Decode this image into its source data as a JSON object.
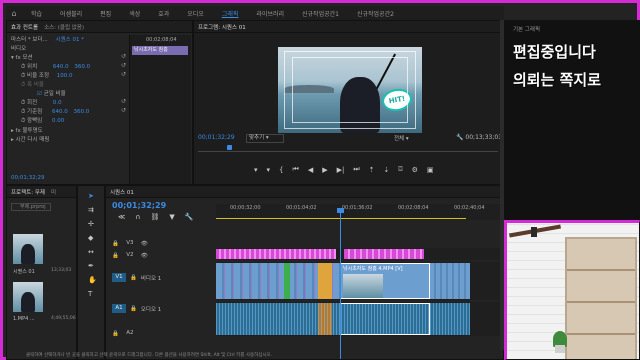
{
  "menu": {
    "items": [
      "학습",
      "어셈블리",
      "편집",
      "색상",
      "효과",
      "오디오",
      "그래픽",
      "라이브러리",
      "신규작업공간1",
      "신규작업공간2"
    ],
    "active_index": 6
  },
  "effect_controls": {
    "tabs": [
      "효과 컨트롤",
      "소스: (클립 없음)"
    ],
    "source": "마스터 * 보더...",
    "sequence": "시퀀스 01 *",
    "timecode": "00;02;08;04",
    "clip_label": "낚시초자도 참홈",
    "section_video": "비디오",
    "motion": "모션",
    "position_label": "위치",
    "position_x": "640.0",
    "position_y": "360.0",
    "scale_label": "비율 조정",
    "scale_value": "100.0",
    "scale_width_label": "폭 비율",
    "uniform_label": "균일 비율",
    "rotation_label": "회전",
    "rotation_value": "0.0",
    "anchor_label": "기준점",
    "anchor_x": "640.0",
    "anchor_y": "360.0",
    "antiflicker_label": "깜빡임",
    "antiflicker_value": "0.00",
    "opacity_label": "불투명도",
    "time_remap_label": "시간 다시 매핑",
    "footer_timecode": "00;01;32;29"
  },
  "program": {
    "tab": "프로그램: 시퀀스 01",
    "timecode": "00;01;32;29",
    "fit": "맞추기",
    "quality": "전체",
    "duration": "00;13;33;03",
    "overlay_badge": "HIT!"
  },
  "essential_graphics": {
    "tab": "기본 그래픽",
    "line1": "편집중입니다",
    "line2": "의뢰는 쪽지로"
  },
  "project": {
    "tabs": [
      "프로젝트: 무제",
      "미"
    ],
    "search_placeholder": "무제.prproj",
    "items": [
      {
        "name": "시퀀스 01",
        "duration": "13;33;03"
      },
      {
        "name": "1.MP4 ...",
        "duration": "4;49;55;06"
      }
    ]
  },
  "timeline": {
    "tab": "시퀀스 01",
    "timecode": "00;01;32;29",
    "ruler_labels": [
      "00;00;32;00",
      "00;01;04;02",
      "00;01;36;02",
      "00;02;08;04",
      "00;02;40;04"
    ],
    "tracks": [
      {
        "name": "V3",
        "label": ""
      },
      {
        "name": "V2",
        "label": ""
      },
      {
        "name": "V1",
        "label": "비디오 1"
      },
      {
        "name": "A1",
        "label": "오디오 1"
      },
      {
        "name": "A2",
        "label": ""
      }
    ],
    "clip_title": "낚시초자도 참홈 4.MP4 [V]"
  },
  "status": {
    "text": "클릭하여 선택하거나 빈 곳을 클릭하고 선택 윤곽으로 드래그합니다. 다른 옵션을 사용하려면 Shift, Alt 및 Ctrl 키를 사용하십시오."
  }
}
